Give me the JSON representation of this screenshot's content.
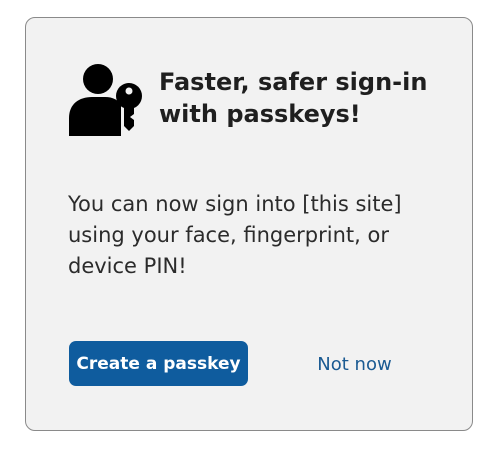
{
  "dialog": {
    "title": "Faster, safer sign-in with passkeys!",
    "description": "You can now sign into [this site] using your face, fingerprint, or device PIN!",
    "icon": "passkey-user-key-icon",
    "primary_button_label": "Create a passkey",
    "secondary_button_label": "Not now"
  },
  "colors": {
    "card_background": "#f2f2f2",
    "card_border": "#8a8a8a",
    "primary_button": "#0f5c9e",
    "link": "#1a5a92",
    "text": "#1f1f1f"
  }
}
